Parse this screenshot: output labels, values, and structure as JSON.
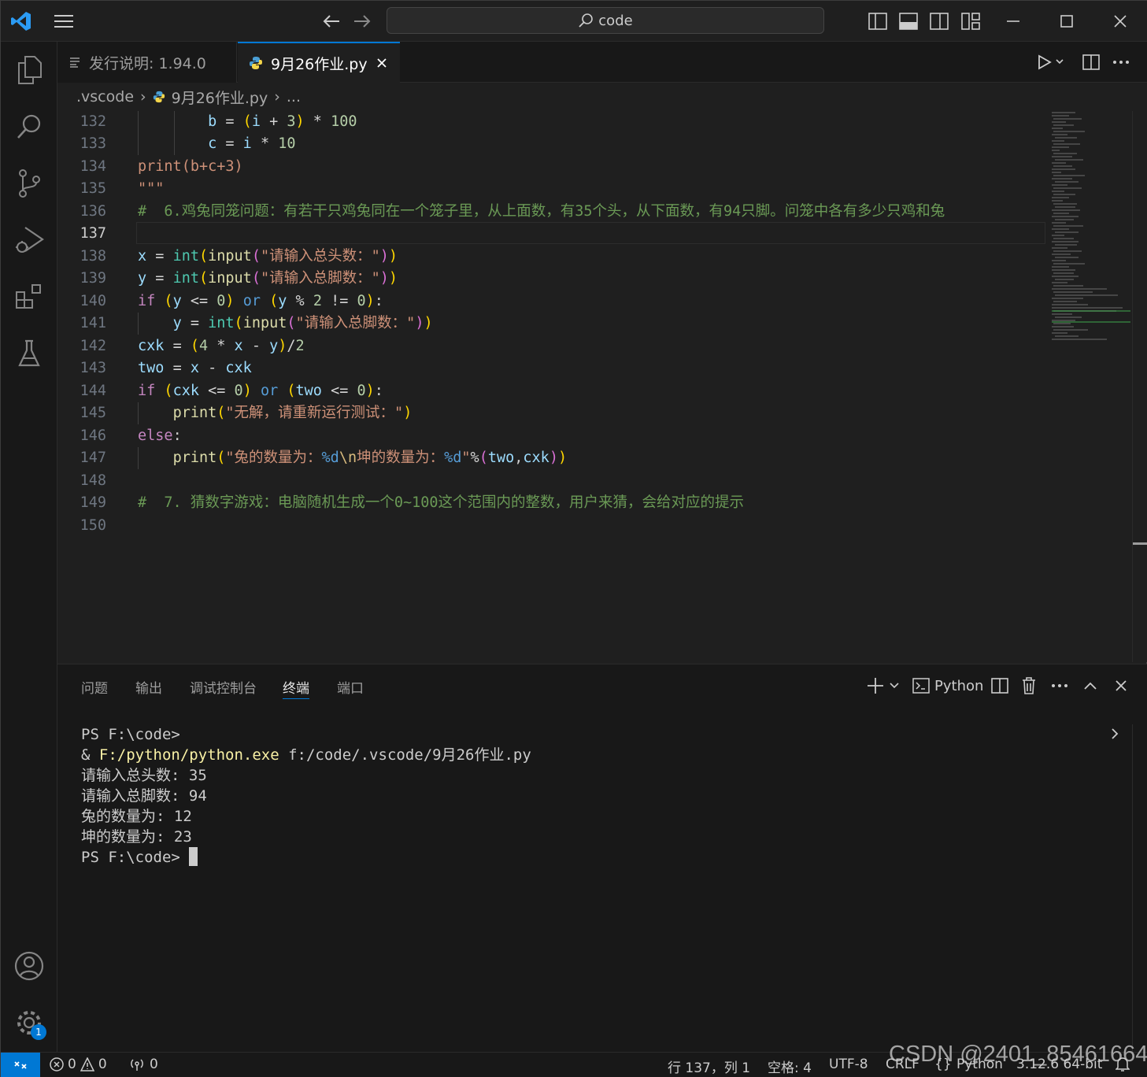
{
  "titlebar": {
    "search_text": "code"
  },
  "tabs": [
    {
      "label": "发行说明: 1.94.0"
    },
    {
      "label": "9月26作业.py"
    }
  ],
  "breadcrumb": {
    "folder": ".vscode",
    "file": "9月26作业.py",
    "more": "..."
  },
  "editor": {
    "line_numbers": [
      "132",
      "133",
      "134",
      "135",
      "136",
      "137",
      "138",
      "139",
      "140",
      "141",
      "142",
      "143",
      "144",
      "145",
      "146",
      "147",
      "148",
      "149",
      "150"
    ],
    "current_line": "137"
  },
  "panel": {
    "tabs": [
      "问题",
      "输出",
      "调试控制台",
      "终端",
      "端口"
    ],
    "active_tab": "终端",
    "shell_label": "Python"
  },
  "terminal": {
    "lines": [
      "PS F:\\code>",
      "& ",
      "F:/python/python.exe",
      " f:/code/.vscode/9月26作业.py",
      "请输入总头数: 35",
      "请输入总脚数: 94",
      "兔的数量为: 12",
      "坤的数量为: 23",
      "PS F:\\code> "
    ]
  },
  "statusbar": {
    "errors": "0",
    "warnings": "0",
    "ports": "0",
    "position": "行 137，列 1",
    "spaces": "空格: 4",
    "encoding": "UTF-8",
    "eol": "CRLF",
    "language": "Python",
    "interpreter": "3.12.6 64-bit"
  },
  "accounts_badge": "1",
  "watermark": "CSDN @2401_85461664",
  "colors": {
    "accent": "#0078d4",
    "background": "#1f1f1f",
    "sidebar": "#181818"
  }
}
